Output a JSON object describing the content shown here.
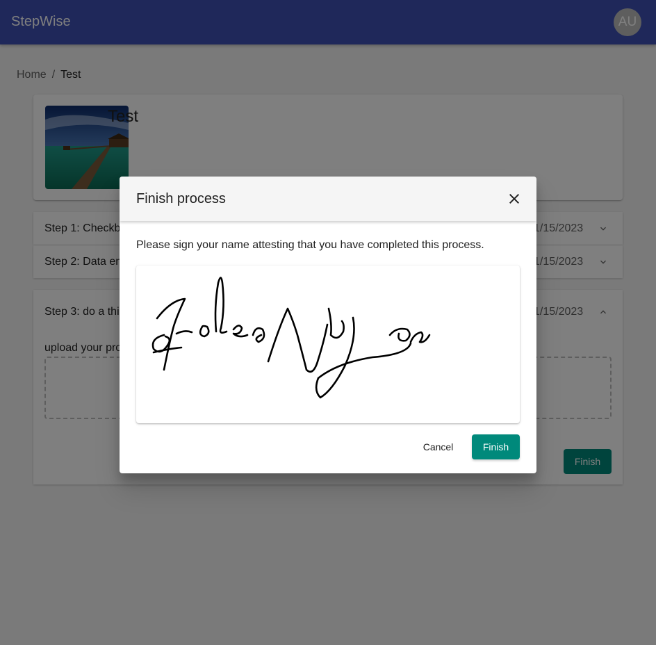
{
  "appbar": {
    "title": "StepWise",
    "avatar_initials": "AU",
    "color": "#3f51b5"
  },
  "breadcrumb": {
    "home": "Home",
    "separator": "/",
    "current": "Test"
  },
  "process": {
    "title": "Test",
    "thumbnail": "overwater-bungalow-pier-image"
  },
  "steps": [
    {
      "title": "Step 1: Checkb",
      "date": "1/15/2023",
      "expanded": false,
      "icon": "chevron-down-icon"
    },
    {
      "title": "Step 2: Data en",
      "date": "1/15/2023",
      "expanded": false,
      "icon": "chevron-down-icon"
    },
    {
      "title": "Step 3: do a thi",
      "date": "1/15/2023",
      "expanded": true,
      "icon": "chevron-up-icon",
      "body_text": "upload your pro",
      "finish_label": "Finish"
    }
  ],
  "dialog": {
    "title": "Finish process",
    "close_icon": "close-icon",
    "instruction": "Please sign your name attesting that you have completed this process.",
    "cancel_label": "Cancel",
    "finish_label": "Finish",
    "accent": "#00897b"
  }
}
